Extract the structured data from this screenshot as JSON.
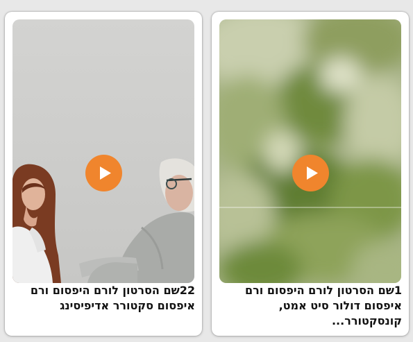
{
  "cards": [
    {
      "title": "1שם הסרטון לורם היפסום ורם איפסום דולור סיט אמט, קונסקטורר...",
      "play_icon": "play-icon"
    },
    {
      "title": "22שם הסרטון לורם היפסום ורם איפסום סקטורר אדיפיסינג",
      "play_icon": "play-icon"
    }
  ],
  "colors": {
    "accent": "#f0852d",
    "card_bg": "#ffffff",
    "page_bg": "#e8e8e8",
    "title_text": "#111111"
  }
}
